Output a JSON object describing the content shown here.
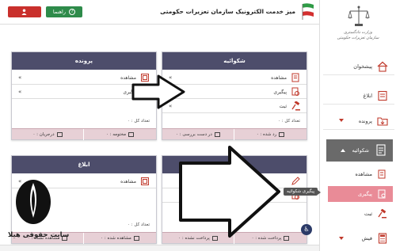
{
  "header": {
    "title": "میز خدمت الکترونیک سازمان تعزیرات حکومتی",
    "help_label": "راهنما",
    "help_icon": "question-icon",
    "user_icon": "user-icon",
    "colors": {
      "red": "#c9302c",
      "green": "#2e8b4a"
    }
  },
  "logo": {
    "line1": "سازمان تعزیرات حکومتی",
    "line2": "وزارت دادگستری"
  },
  "sidebar": {
    "items": [
      {
        "label": "پیشخوان",
        "icon": "home-icon"
      },
      {
        "label": "ابلاغ",
        "icon": "notice-icon"
      },
      {
        "label": "پرونده",
        "icon": "folder-icon"
      },
      {
        "label": "شکوائیه",
        "icon": "complaint-icon"
      }
    ],
    "sub_items": [
      {
        "label": "مشاهده",
        "icon": "view-icon"
      },
      {
        "label": "پیگیری",
        "icon": "track-icon"
      },
      {
        "label": "ثبت",
        "icon": "gavel-icon"
      }
    ],
    "last_item": {
      "label": "فیش",
      "icon": "calculator-icon"
    }
  },
  "cards": {
    "shekvaiye": {
      "title": "شکوائیه",
      "rows": [
        "مشاهده",
        "پیگیری",
        "ثبت"
      ],
      "count": "تعداد کل : ۰",
      "foot_left": "در دست بررسی : ۰",
      "foot_right": "رد شده : ۰"
    },
    "parvande": {
      "title": "پرونده",
      "rows": [
        "مشاهده",
        "پیگیری"
      ],
      "count": "تعداد کل : ۰",
      "foot_left": "درجریان : ۰",
      "foot_right": "مختومه : ۰"
    },
    "eblagh": {
      "title": "ابلاغ",
      "rows": [
        "مشاهده"
      ],
      "count": "تعداد کل : ۰",
      "foot_left": "مشاهده نشده : ۰",
      "foot_right": "مشاهده شده : ۰"
    },
    "fish": {
      "foot_left": "پرداخت نشده : ۰",
      "foot_right": "پرداخت شده : ۰"
    }
  },
  "tooltip": "پیگیری شکوائیه",
  "watermark": "سایت حقوقی هیلا"
}
